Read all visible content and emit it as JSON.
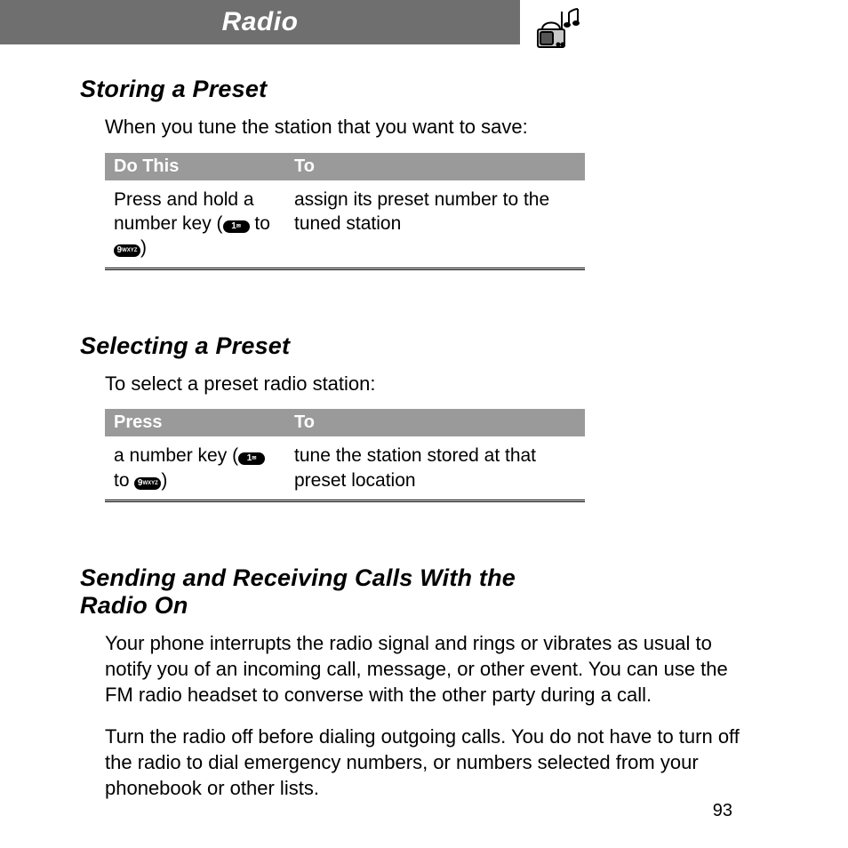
{
  "header": {
    "title": "Radio",
    "icon": "radio-music-icon"
  },
  "sections": [
    {
      "heading": "Storing a Preset",
      "lead": "When you tune the station that you want to save:",
      "table": {
        "headers": [
          "Do This",
          "To"
        ],
        "rows": [
          {
            "col1_pre": "Press and hold a number key (",
            "key1": "1",
            "col1_mid": " to ",
            "key2": "9",
            "col1_post": ")",
            "col2": "assign its preset number to the tuned station"
          }
        ]
      }
    },
    {
      "heading": "Selecting a Preset",
      "lead": "To select a preset radio station:",
      "table": {
        "headers": [
          "Press",
          "To"
        ],
        "rows": [
          {
            "col1_pre": "a number key (",
            "key1": "1",
            "col1_mid": " to ",
            "key2": "9",
            "col1_post": ")",
            "col2": "tune the station stored at that preset location"
          }
        ]
      }
    },
    {
      "heading": "Sending and Receiving Calls With the Radio On",
      "paragraphs": [
        "Your phone interrupts the radio signal and rings or vibrates as usual to notify you of an incoming call, message, or other event. You can use the FM radio headset to converse with the other party during a call.",
        "Turn the radio off before dialing outgoing calls. You do not have to turn off the radio to dial emergency numbers, or numbers selected from your phonebook or other lists."
      ]
    }
  ],
  "page_number": "93"
}
